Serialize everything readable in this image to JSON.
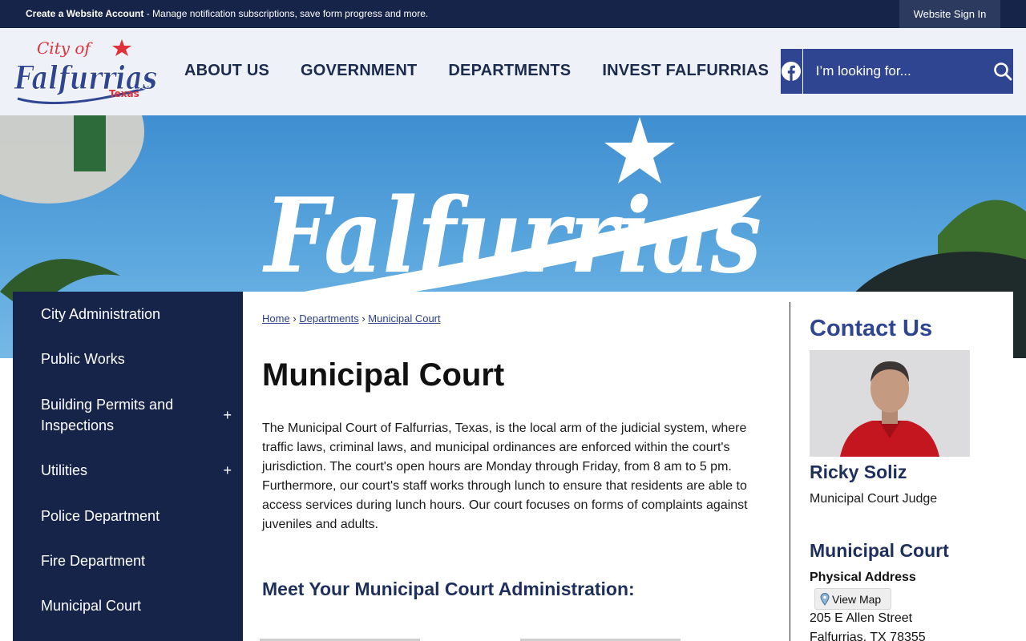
{
  "topbar": {
    "account_link": "Create a Website Account",
    "account_text": " - Manage notification subscriptions, save form progress and more.",
    "sign_in": "Website Sign In"
  },
  "header": {
    "logo_text_top": "City of",
    "logo_text_main": "Falfurrias",
    "logo_text_sub": "Texas",
    "nav": [
      "ABOUT US",
      "GOVERNMENT",
      "DEPARTMENTS",
      "INVEST FALFURRIAS"
    ],
    "search_placeholder": "I’m looking for..."
  },
  "hero": {
    "text": "Falfurrias"
  },
  "sidebar": {
    "items": [
      {
        "label": "City Administration",
        "expandable": false
      },
      {
        "label": "Public Works",
        "expandable": false
      },
      {
        "label": "Building Permits and Inspections",
        "expandable": true
      },
      {
        "label": "Utilities",
        "expandable": true
      },
      {
        "label": "Police Department",
        "expandable": false
      },
      {
        "label": "Fire Department",
        "expandable": false
      },
      {
        "label": "Municipal Court",
        "expandable": false
      }
    ],
    "expand_symbol": "+"
  },
  "breadcrumb": {
    "home": "Home",
    "departments": "Departments",
    "current": "Municipal Court",
    "separator": "›"
  },
  "main": {
    "title": "Municipal Court",
    "intro": "The Municipal Court of Falfurrias, Texas, is the local arm of the judicial system, where traffic laws, criminal laws, and municipal ordinances are enforced within the court's jurisdiction. The court's open hours are Monday through Friday, from 8 am to 5 pm. Furthermore, our court's staff works through lunch to ensure that residents are able to access services during lunch hours. Our court focuses on forms of complaints against juveniles and adults.",
    "subheading": "Meet Your Municipal Court Administration:"
  },
  "contact": {
    "title": "Contact Us",
    "name": "Ricky Soliz",
    "role": "Municipal Court Judge",
    "department": "Municipal Court",
    "address_label": "Physical Address",
    "map_button": "View Map",
    "street": "205 E Allen Street",
    "city": "Falfurrias, TX 78355"
  },
  "colors": {
    "navy": "#16244a",
    "brand_blue": "#2f4592",
    "heading_navy": "#1e2f5c",
    "logo_red": "#e0313b"
  }
}
